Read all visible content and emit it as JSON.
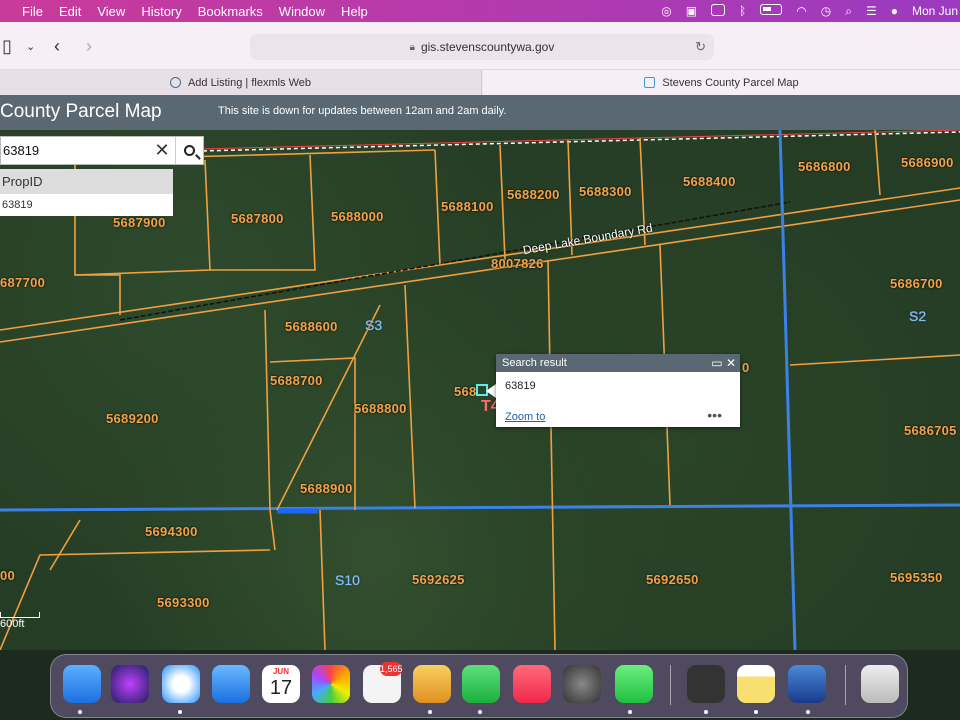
{
  "menubar": {
    "apple": "",
    "items": [
      "File",
      "Edit",
      "View",
      "History",
      "Bookmarks",
      "Window",
      "Help"
    ],
    "clock": "Mon Jun"
  },
  "browser": {
    "url": "gis.stevenscountywa.gov",
    "tabs": [
      {
        "label": "Add Listing | flexmls Web"
      },
      {
        "label": "Stevens County Parcel Map"
      }
    ]
  },
  "app": {
    "title": "County Parcel Map",
    "notice": "This site is down for updates between 12am and 2am daily."
  },
  "search": {
    "value": "63819",
    "suggest_header": "PropID",
    "suggest_item": "63819"
  },
  "popup": {
    "title": "Search result",
    "value": "63819",
    "zoom_link": "Zoom to",
    "more": "•••"
  },
  "map": {
    "road": "Deep Lake Boundary Rd",
    "parcels": {
      "p5686800": "5686800",
      "p5686900": "5686900",
      "p5688100": "5688100",
      "p5688200": "5688200",
      "p5688300": "5688300",
      "p5688400": "5688400",
      "p5687800": "5687800",
      "p5688000": "5688000",
      "p5687900": "5687900",
      "p8007826": "8007826",
      "p687700": "687700",
      "p5686700": "5686700",
      "p5688600": "5688600",
      "p5688700": "5688700",
      "p5688800": "5688800",
      "p5689200": "5689200",
      "p5686705": "5686705",
      "p5688900": "5688900",
      "p5694300": "5694300",
      "p5692625": "5692625",
      "p5692650": "5692650",
      "p5695350": "5695350",
      "p5693300": "5693300",
      "p568_partial": "568",
      "p00_partial": "00",
      "p0_partial": "0"
    },
    "sections": {
      "s3": "S3",
      "s2": "S2",
      "s10": "S10"
    },
    "township": "T4",
    "scale": "600ft"
  },
  "dock": {
    "calendar_month": "JUN",
    "calendar_day": "17",
    "reminders_badge": "1,565"
  }
}
